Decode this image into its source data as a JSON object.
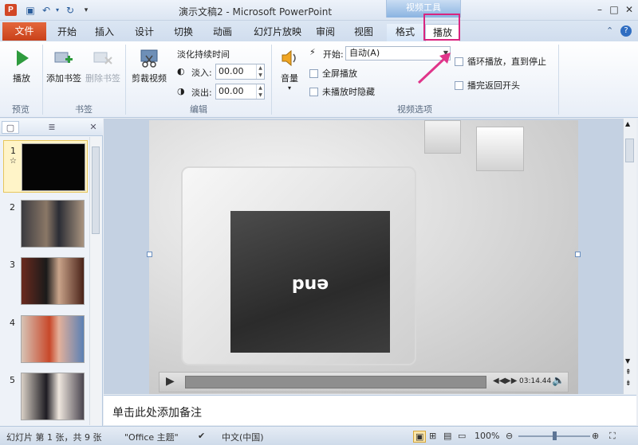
{
  "window": {
    "title": "演示文稿2 - Microsoft PowerPoint",
    "context_tab_group": "视频工具",
    "app_icon_letter": "P"
  },
  "ribbon_tabs": [
    "文件",
    "开始",
    "插入",
    "设计",
    "切换",
    "动画",
    "幻灯片放映",
    "审阅",
    "视图",
    "格式",
    "播放"
  ],
  "ribbon": {
    "preview": {
      "play_label": "播放",
      "group_label": "预览"
    },
    "bookmarks": {
      "add_label": "添加书签",
      "remove_label": "删除书签",
      "group_label": "书签"
    },
    "editing": {
      "trim_label": "剪裁视频",
      "fade_title": "淡化持续时间",
      "fade_in_label": "淡入:",
      "fade_in_value": "00.00",
      "fade_out_label": "淡出:",
      "fade_out_value": "00.00",
      "group_label": "编辑"
    },
    "video_options": {
      "volume_label": "音量",
      "start_label": "开始:",
      "start_value": "自动(A)",
      "fullscreen_label": "全屏播放",
      "hide_label": "未播放时隐藏",
      "loop_label": "循环播放，直到停止",
      "rewind_label": "播完返回开头",
      "group_label": "视频选项"
    }
  },
  "slides": [
    {
      "num": "1",
      "kind": "black"
    },
    {
      "num": "2",
      "kind": "photo"
    },
    {
      "num": "3",
      "kind": "photo"
    },
    {
      "num": "4",
      "kind": "photo"
    },
    {
      "num": "5",
      "kind": "photo"
    }
  ],
  "video": {
    "screen_text": "end",
    "time": "03:14.44"
  },
  "notes_placeholder": "单击此处添加备注",
  "status": {
    "slide_info": "幻灯片 第 1 张，共 9 张",
    "theme": "\"Office 主题\"",
    "language": "中文(中国)",
    "zoom": "100%"
  }
}
